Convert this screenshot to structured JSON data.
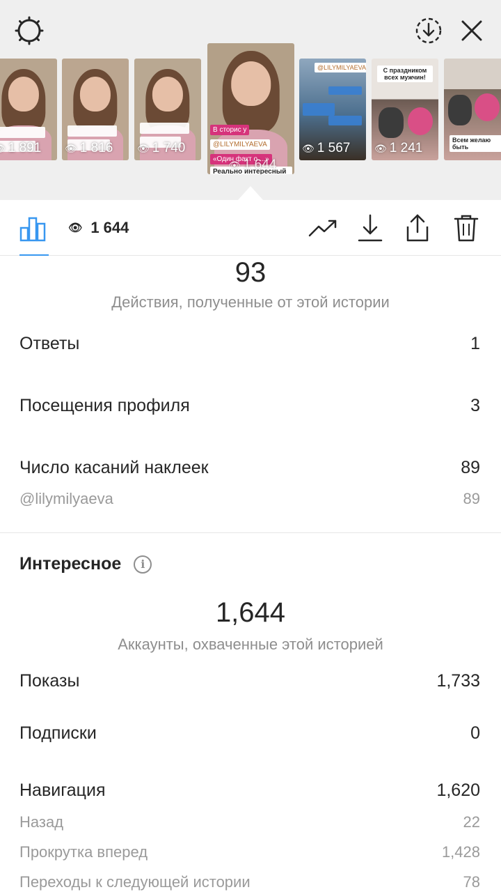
{
  "header": {
    "settings_icon": "settings-gear-icon",
    "download_icon": "download-circle-icon",
    "close_icon": "close-icon"
  },
  "thumbnails": [
    {
      "views": "1 891",
      "bg": "#b8a58f"
    },
    {
      "views": "1 816",
      "bg": "#bba690"
    },
    {
      "views": "1 740",
      "bg": "#b9a892"
    },
    {
      "views": "1 644",
      "bg": "#b3a088",
      "selected": true,
      "tag_handle": "@LILYMILYAEVA",
      "tag_line1": "В сторис у",
      "tag_line2": "«Один факт о ...»",
      "tag_line3": "Реально интересный факт!"
    },
    {
      "views": "1 567",
      "bg": "#4c6f8e",
      "tag_handle": "@LILYMILYAEVA"
    },
    {
      "views": "1 241",
      "bg": "#6b5a52",
      "tag_line1": "С праздником всех мужчин!"
    },
    {
      "views": "",
      "bg": "#7a6a5e",
      "tag_line1": "Всем желаю быть"
    }
  ],
  "toolbar": {
    "views_count": "1 644",
    "tabs": [
      "insights-tab",
      "views-tab"
    ],
    "actions": [
      "promote-icon",
      "save-icon",
      "share-icon",
      "delete-icon"
    ]
  },
  "interactions": {
    "total": "93",
    "caption": "Действия, полученные от этой истории",
    "rows": [
      {
        "label": "Ответы",
        "value": "1"
      },
      {
        "label": "Посещения профиля",
        "value": "3"
      },
      {
        "label": "Число касаний наклеек",
        "value": "89"
      }
    ],
    "sticker_rows": [
      {
        "label": "@lilymilyaeva",
        "value": "89"
      }
    ]
  },
  "discovery": {
    "title": "Интересное",
    "total": "1,644",
    "caption": "Аккаунты, охваченные этой историей",
    "rows": [
      {
        "label": "Показы",
        "value": "1,733"
      },
      {
        "label": "Подписки",
        "value": "0"
      },
      {
        "label": "Навигация",
        "value": "1,620"
      }
    ],
    "nav_rows": [
      {
        "label": "Назад",
        "value": "22"
      },
      {
        "label": "Прокрутка вперед",
        "value": "1,428"
      },
      {
        "label": "Переходы к следующей истории",
        "value": "78"
      }
    ]
  },
  "colors": {
    "accent_blue": "#3897f0",
    "text": "#262626",
    "muted": "#8e8e8e",
    "top_bg": "#efefef"
  }
}
